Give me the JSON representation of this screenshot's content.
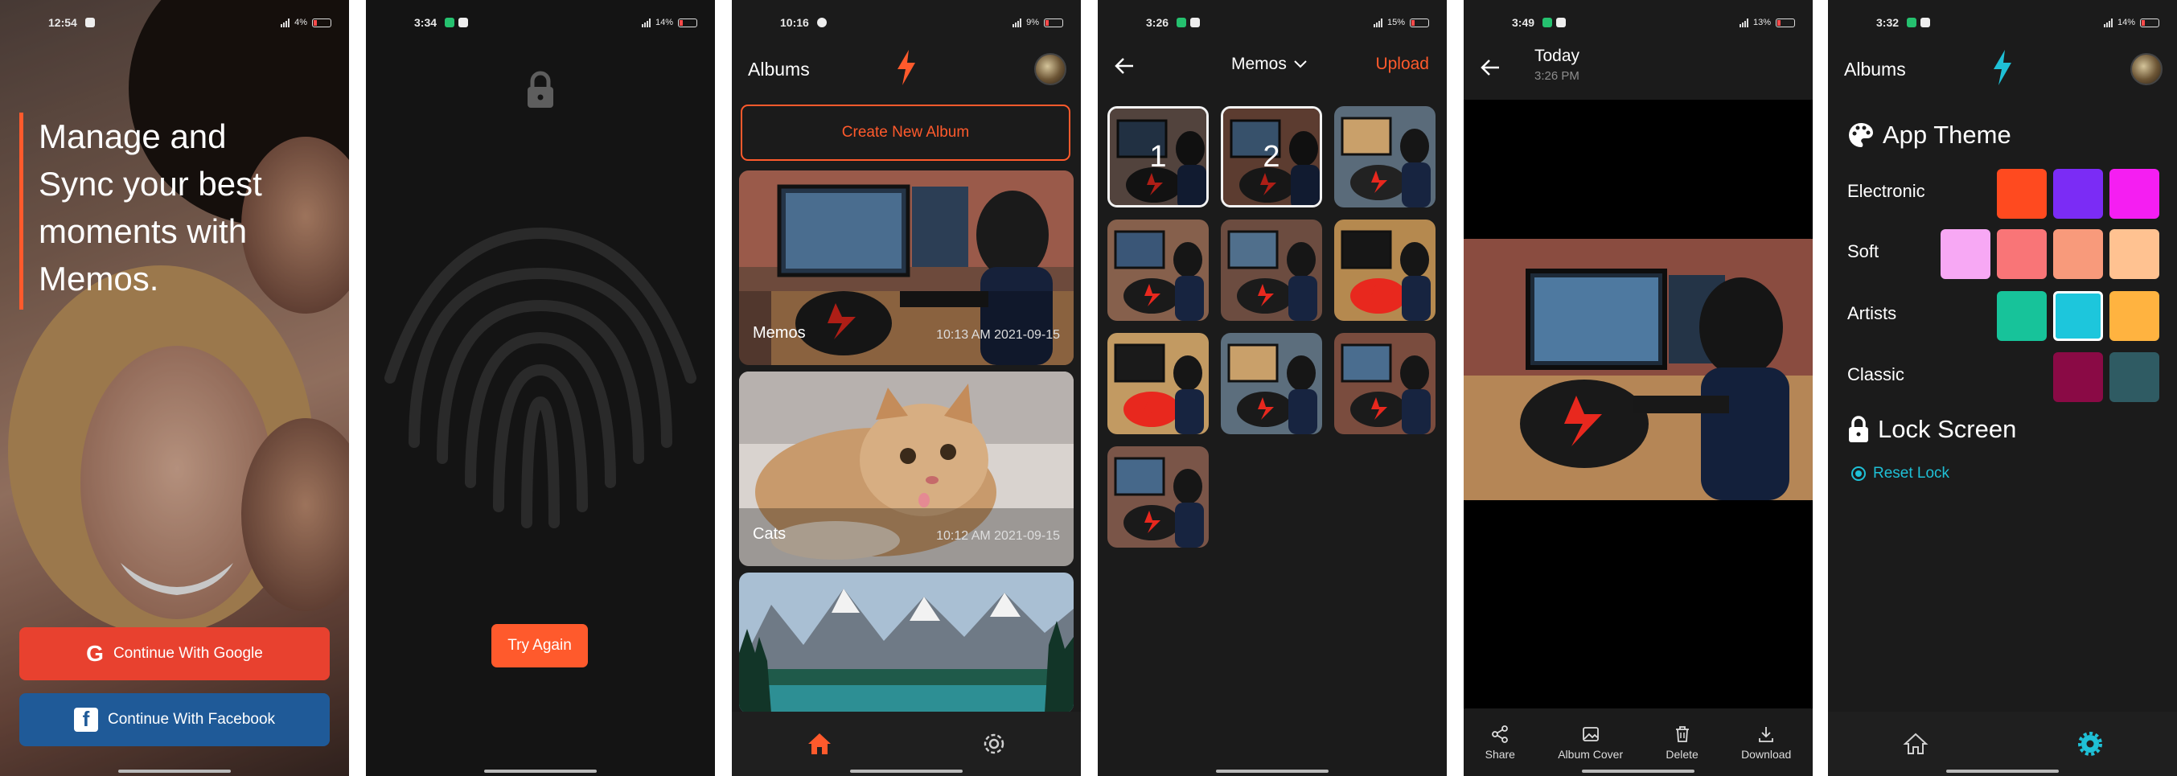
{
  "screen1": {
    "status": {
      "time": "12:54",
      "battery": "4%"
    },
    "tagline": "Manage and Sync your best moments with Memos.",
    "google_button": "Continue With Google",
    "facebook_button": "Continue With Facebook",
    "google_glyph": "G",
    "facebook_glyph": "f"
  },
  "screen2": {
    "status": {
      "time": "3:34",
      "battery": "14%"
    },
    "try_again": "Try Again"
  },
  "screen3": {
    "status": {
      "time": "10:16",
      "battery": "9%"
    },
    "title": "Albums",
    "create_button": "Create New Album",
    "albums": [
      {
        "name": "Memos",
        "date": "10:13 AM 2021-09-15"
      },
      {
        "name": "Cats",
        "date": "10:12 AM 2021-09-15"
      },
      {
        "name": "",
        "date": ""
      }
    ]
  },
  "screen4": {
    "status": {
      "time": "3:26",
      "battery": "15%"
    },
    "album_dropdown": "Memos",
    "upload": "Upload",
    "selected_numbers": [
      "1",
      "2"
    ]
  },
  "screen5": {
    "status": {
      "time": "3:49",
      "battery": "13%"
    },
    "title": "Today",
    "subtitle": "3:26 PM",
    "actions": [
      "Share",
      "Album Cover",
      "Delete",
      "Download"
    ]
  },
  "screen6": {
    "status": {
      "time": "3:32",
      "battery": "14%"
    },
    "title": "Albums",
    "app_theme": "App Theme",
    "themes": [
      {
        "label": "Electronic",
        "colors": [
          "#ff4a1f",
          "#7b2cf5",
          "#f51ef2"
        ]
      },
      {
        "label": "Soft",
        "colors": [
          "#f7a8f4",
          "#f97577",
          "#f89a7b",
          "#ffc291"
        ]
      },
      {
        "label": "Artists",
        "colors": [
          "#17c39a",
          "#1dc6dc",
          "#ffb340"
        ]
      },
      {
        "label": "Classic",
        "colors": [
          "#8a0a45",
          "#2f5b63"
        ]
      }
    ],
    "selected_theme": "Artists",
    "lock_screen": "Lock Screen",
    "reset_lock": "Reset Lock"
  },
  "colors": {
    "accent": "#ff5a2c",
    "cyan_accent": "#1fc0d6",
    "background": "#1b1b1b"
  }
}
